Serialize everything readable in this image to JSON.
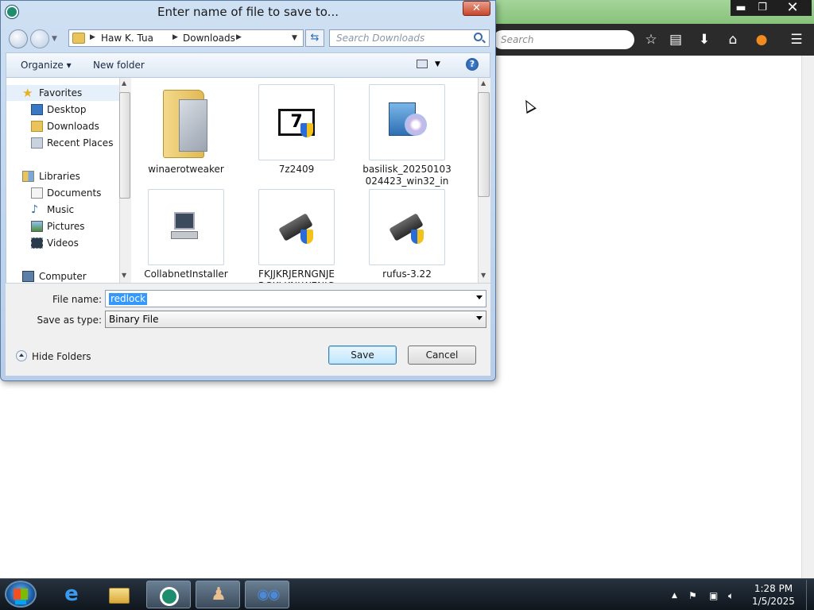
{
  "browser": {
    "search_placeholder": "Search",
    "icons": [
      "bookmark-star-icon",
      "reading-list-icon",
      "download-icon",
      "home-icon",
      "firefox-icon",
      "menu-icon"
    ],
    "window_buttons": {
      "minimize": "▬",
      "maximize": "❐",
      "close": "✕"
    }
  },
  "dialog": {
    "title": "Enter name of file to save to...",
    "close_glyph": "✕",
    "address": {
      "crumbs": [
        "Haw K. Tua",
        "Downloads"
      ]
    },
    "search_placeholder": "Search Downloads",
    "toolbar": {
      "organize": "Organize ▾",
      "new_folder": "New folder",
      "help": "?"
    },
    "nav": {
      "favorites": "Favorites",
      "desktop": "Desktop",
      "downloads": "Downloads",
      "recent": "Recent Places",
      "libraries": "Libraries",
      "documents": "Documents",
      "music": "Music",
      "pictures": "Pictures",
      "videos": "Videos",
      "computer": "Computer"
    },
    "files": [
      {
        "name": "winaerotweaker",
        "icon": "folder-icon"
      },
      {
        "name": "7z2409",
        "icon": "7zip-installer-icon"
      },
      {
        "name": "basilisk_20250103\n024423_win32_in",
        "icon": "installer-cd-icon"
      },
      {
        "name": "CollabnetInstaller",
        "icon": "installer-computer-icon"
      },
      {
        "name": "FKJJKRJERNGNJE\nRGKLKNLWENJG",
        "icon": "usb-shield-icon"
      },
      {
        "name": "rufus-3.22",
        "icon": "usb-shield-icon"
      }
    ],
    "file_name_label": "File name:",
    "file_name_value": "redlock",
    "save_type_label": "Save as type:",
    "save_type_value": "Binary File",
    "hide_folders": "Hide Folders",
    "save": "Save",
    "cancel": "Cancel"
  },
  "taskbar": {
    "items": [
      "start-button",
      "internet-explorer-icon",
      "file-explorer-icon",
      "app-green-icon",
      "app-chess-icon",
      "app-eyes-icon"
    ],
    "time": "1:28 PM",
    "date": "1/5/2025"
  }
}
